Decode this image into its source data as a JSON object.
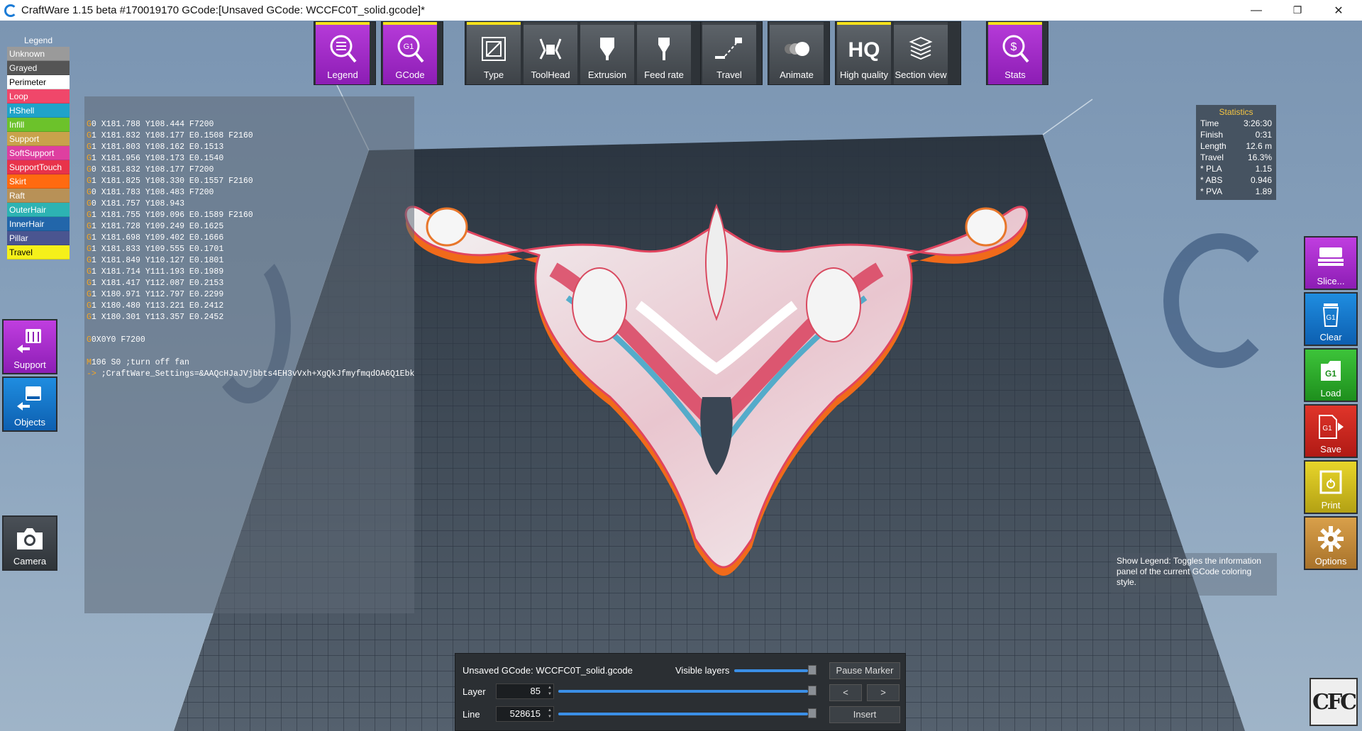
{
  "window": {
    "title": "CraftWare 1.15 beta #170019170   GCode:[Unsaved GCode: WCCFC0T_solid.gcode]*",
    "minimize": "—",
    "maximize": "❐",
    "close": "✕"
  },
  "toolbar": {
    "legend": "Legend",
    "gcode": "GCode",
    "type": "Type",
    "toolhead": "ToolHead",
    "extrusion": "Extrusion",
    "feedrate": "Feed rate",
    "travel": "Travel",
    "animate": "Animate",
    "highquality": "High quality",
    "hq_icon": "HQ",
    "sectionview": "Section view",
    "stats": "Stats"
  },
  "legend": {
    "title": "Legend",
    "items": [
      {
        "label": "Unknown",
        "color": "#9a9a9a"
      },
      {
        "label": "Grayed",
        "color": "#555555"
      },
      {
        "label": "Perimeter",
        "color": "#ffffff"
      },
      {
        "label": "Loop",
        "color": "#f0476a"
      },
      {
        "label": "HShell",
        "color": "#1fa3c9"
      },
      {
        "label": "Infill",
        "color": "#6cc22b"
      },
      {
        "label": "Support",
        "color": "#c9a24b"
      },
      {
        "label": "SoftSupport",
        "color": "#de3fa0"
      },
      {
        "label": "SupportTouch",
        "color": "#e8334a"
      },
      {
        "label": "Skirt",
        "color": "#ff6a10"
      },
      {
        "label": "Raft",
        "color": "#b89157"
      },
      {
        "label": "OuterHair",
        "color": "#2db3b3"
      },
      {
        "label": "InnerHair",
        "color": "#2266aa"
      },
      {
        "label": "Pillar",
        "color": "#4a5590"
      },
      {
        "label": "Travel",
        "color": "#f5f01a"
      }
    ]
  },
  "gcode_lines": [
    {
      "k": "G",
      "t": "0 X181.788 Y108.444 F7200"
    },
    {
      "k": "G",
      "t": "1 X181.832 Y108.177 E0.1508 F2160"
    },
    {
      "k": "G",
      "t": "1 X181.803 Y108.162 E0.1513"
    },
    {
      "k": "G",
      "t": "1 X181.956 Y108.173 E0.1540"
    },
    {
      "k": "G",
      "t": "0 X181.832 Y108.177 F7200"
    },
    {
      "k": "G",
      "t": "1 X181.825 Y108.330 E0.1557 F2160"
    },
    {
      "k": "G",
      "t": "0 X181.783 Y108.483 F7200"
    },
    {
      "k": "G",
      "t": "0 X181.757 Y108.943"
    },
    {
      "k": "G",
      "t": "1 X181.755 Y109.096 E0.1589 F2160"
    },
    {
      "k": "G",
      "t": "1 X181.728 Y109.249 E0.1625"
    },
    {
      "k": "G",
      "t": "1 X181.698 Y109.402 E0.1666"
    },
    {
      "k": "G",
      "t": "1 X181.833 Y109.555 E0.1701"
    },
    {
      "k": "G",
      "t": "1 X181.849 Y110.127 E0.1801"
    },
    {
      "k": "G",
      "t": "1 X181.714 Y111.193 E0.1989"
    },
    {
      "k": "G",
      "t": "1 X181.417 Y112.087 E0.2153"
    },
    {
      "k": "G",
      "t": "1 X180.971 Y112.797 E0.2299"
    },
    {
      "k": "G",
      "t": "1 X180.480 Y113.221 E0.2412"
    },
    {
      "k": "G",
      "t": "1 X180.301 Y113.357 E0.2452"
    },
    {
      "k": "",
      "t": ""
    },
    {
      "k": "G",
      "t": "0X0Y0 F7200"
    },
    {
      "k": "",
      "t": ""
    },
    {
      "k": "M",
      "t": "106 S0 ;turn off fan"
    },
    {
      "k": "->",
      "t": " ;CraftWare_Settings=&AAQcHJaJVjbbts4EH3vVxh+XgQkJfmyfmqdOA6Q1Ebk..."
    }
  ],
  "left_buttons": {
    "support": "Support",
    "objects": "Objects",
    "camera": "Camera"
  },
  "right_buttons": {
    "slice": "Slice...",
    "clear": "Clear",
    "load": "Load",
    "save": "Save",
    "print": "Print",
    "options": "Options"
  },
  "stats": {
    "title": "Statistics",
    "rows": [
      {
        "k": "Time",
        "v": "3:26:30"
      },
      {
        "k": "Finish",
        "v": "0:31"
      },
      {
        "k": "Length",
        "v": "12.6 m"
      },
      {
        "k": "Travel",
        "v": "16.3%"
      },
      {
        "k": " * PLA",
        "v": "1.15"
      },
      {
        "k": " * ABS",
        "v": "0.946"
      },
      {
        "k": " * PVA",
        "v": "1.89"
      }
    ]
  },
  "hint": "Show Legend: Toggles the information panel of the current GCode coloring style.",
  "bottom": {
    "filename": "Unsaved GCode: WCCFC0T_solid.gcode",
    "visible_layers": "Visible layers",
    "layer_label": "Layer",
    "layer_value": "85",
    "line_label": "Line",
    "line_value": "528615",
    "pause_marker": "Pause Marker",
    "prev": "<",
    "next": ">",
    "insert": "Insert"
  },
  "logo": "CFC"
}
